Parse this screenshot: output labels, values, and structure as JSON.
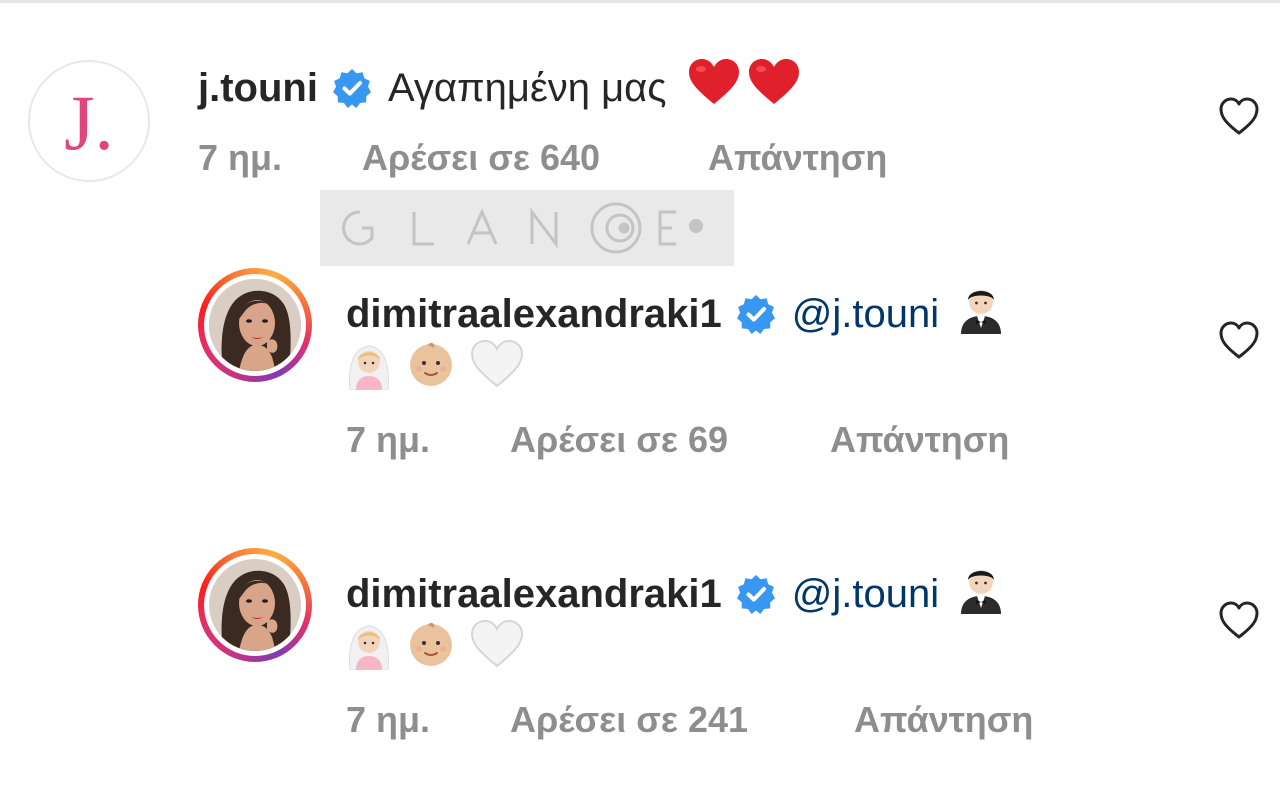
{
  "comments": [
    {
      "username": "j.touni",
      "verified": true,
      "text": "Αγαπημένη μας",
      "emojis": [
        "red-heart",
        "red-heart"
      ],
      "time": "7 ημ.",
      "likes": "Αρέσει σε 640",
      "reply": "Απάντηση"
    },
    {
      "username": "dimitraalexandraki1",
      "verified": true,
      "mention": "@j.touni",
      "emojis": [
        "man-in-tuxedo",
        "bride-with-veil",
        "baby",
        "white-heart"
      ],
      "time": "7 ημ.",
      "likes": "Αρέσει σε 69",
      "reply": "Απάντηση"
    },
    {
      "username": "dimitraalexandraki1",
      "verified": true,
      "mention": "@j.touni",
      "emojis": [
        "man-in-tuxedo",
        "bride-with-veil",
        "baby",
        "white-heart"
      ],
      "time": "7 ημ.",
      "likes": "Αρέσει σε 241",
      "reply": "Απάντηση"
    }
  ],
  "watermark": "GLANCE",
  "colors": {
    "verified_badge": "#3897f0",
    "mention": "#00376b",
    "meta_text": "#8e8e8e",
    "brand_j": "#e0457b"
  }
}
